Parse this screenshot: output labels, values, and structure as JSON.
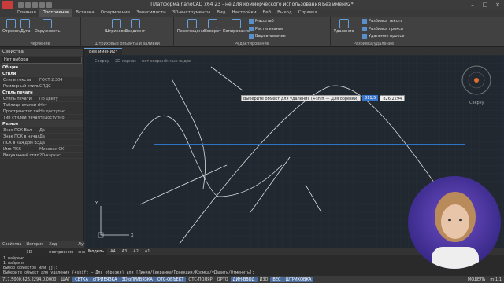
{
  "window": {
    "title": "Платформа nanoCAD x64 23 - не для коммерческого использования Без имени2*",
    "controls": [
      "–",
      "□",
      "×"
    ]
  },
  "menu": {
    "items": [
      "Главная",
      "Построение",
      "Вставка",
      "Оформление",
      "Зависимости",
      "3D-инструменты",
      "Вид",
      "Настройки",
      "Веб",
      "Выход",
      "Справка"
    ],
    "active_index": 1
  },
  "ribbon": {
    "groups": [
      {
        "label": "Черчение",
        "buttons": [
          "Отрезок",
          "Дуга",
          "Окружность"
        ]
      },
      {
        "label": "Штриховые объекты и заливки",
        "buttons": [
          "Штриховка",
          "Градиент"
        ]
      },
      {
        "label": "Редактирование",
        "buttons": [
          "Перемещение",
          "Поворот",
          "Копирование"
        ],
        "small": [
          "Масштаб",
          "Растягивание",
          "Выравнивание"
        ]
      },
      {
        "label": "Разбивка/удаление",
        "buttons": [
          "Удаление"
        ],
        "small": [
          "Разбивка текста",
          "Разбивка прокси",
          "Удаление прокси"
        ]
      }
    ]
  },
  "doc_tabs": [
    "Без имени2*"
  ],
  "properties": {
    "title": "Свойства",
    "selection": "Нет выбора",
    "sections": [
      {
        "name": "Общие",
        "rows": []
      },
      {
        "name": "Стили",
        "rows": [
          [
            "Стиль текста",
            "ГОСТ 2.304"
          ],
          [
            "Размерный стиль",
            "СПДС"
          ]
        ]
      },
      {
        "name": "Стиль печати",
        "rows": [
          [
            "Стиль печати",
            "По цвету"
          ],
          [
            "Таблица стилей печати",
            "Нет"
          ],
          [
            "Пространство таблиц",
            "Не доступно"
          ],
          [
            "Тип стилей печати",
            "Недоступно"
          ]
        ]
      },
      {
        "name": "Разное",
        "rows": [
          [
            "Знак ПСК Вкл",
            "Да"
          ],
          [
            "Знак ПСК в начале к.",
            "Да"
          ],
          [
            "ПСК в каждом ВЭкране",
            "Да"
          ],
          [
            "Имя ПСК",
            "Мировая СК"
          ],
          [
            "Визуальный стиль",
            "2D-каркас"
          ]
        ]
      }
    ],
    "footer_tabs": [
      "Свойства",
      "История 3D-моделей",
      "Ход построения",
      "Лучшие знаки"
    ]
  },
  "canvas": {
    "view_labels": [
      "Сверху",
      "2D-каркас",
      "нет сохранённых видов"
    ],
    "viewcube": "Сверху",
    "ucs_x": "X",
    "ucs_y": "Y",
    "bg": "#212830",
    "accent": "#2e74c8"
  },
  "tooltip": {
    "prompt": "Выберите объект для удаления (+shift — Для обрезки)",
    "field1": "311,5",
    "field2": "826,2294"
  },
  "layout_tabs": [
    "Модель",
    "A4",
    "A3",
    "A2",
    "A1"
  ],
  "command_line": [
    "1 найдено",
    "1 найдено",
    "Выбор объектов или [ј]:",
    "Выберите объект для удаления (+shift — Для обрезки) или [Линия/Секрамка/Проекция/Кромка/уДалить/Отменить]:"
  ],
  "statusbar": {
    "coords": "717,5000,626,2294,0,0000",
    "items": [
      {
        "label": "ШАГ",
        "on": false
      },
      {
        "label": "СЕТКА",
        "on": true
      },
      {
        "label": "оПРИВЯЗКА",
        "on": true
      },
      {
        "label": "3D оПРИВЯЗКА",
        "on": true
      },
      {
        "label": "ОТС-ОБЪЕКТ",
        "on": true
      },
      {
        "label": "ОТС-ПОЛЯР",
        "on": false
      },
      {
        "label": "ОРТО",
        "on": false
      },
      {
        "label": "ДИН-ВВОД",
        "on": true
      },
      {
        "label": "ИЗО",
        "on": false
      },
      {
        "label": "ВЕС",
        "on": true
      },
      {
        "label": "ШТРИХОВКА",
        "on": true
      }
    ],
    "model_label": "МОДЕЛЬ",
    "scale": "m:1:1"
  }
}
